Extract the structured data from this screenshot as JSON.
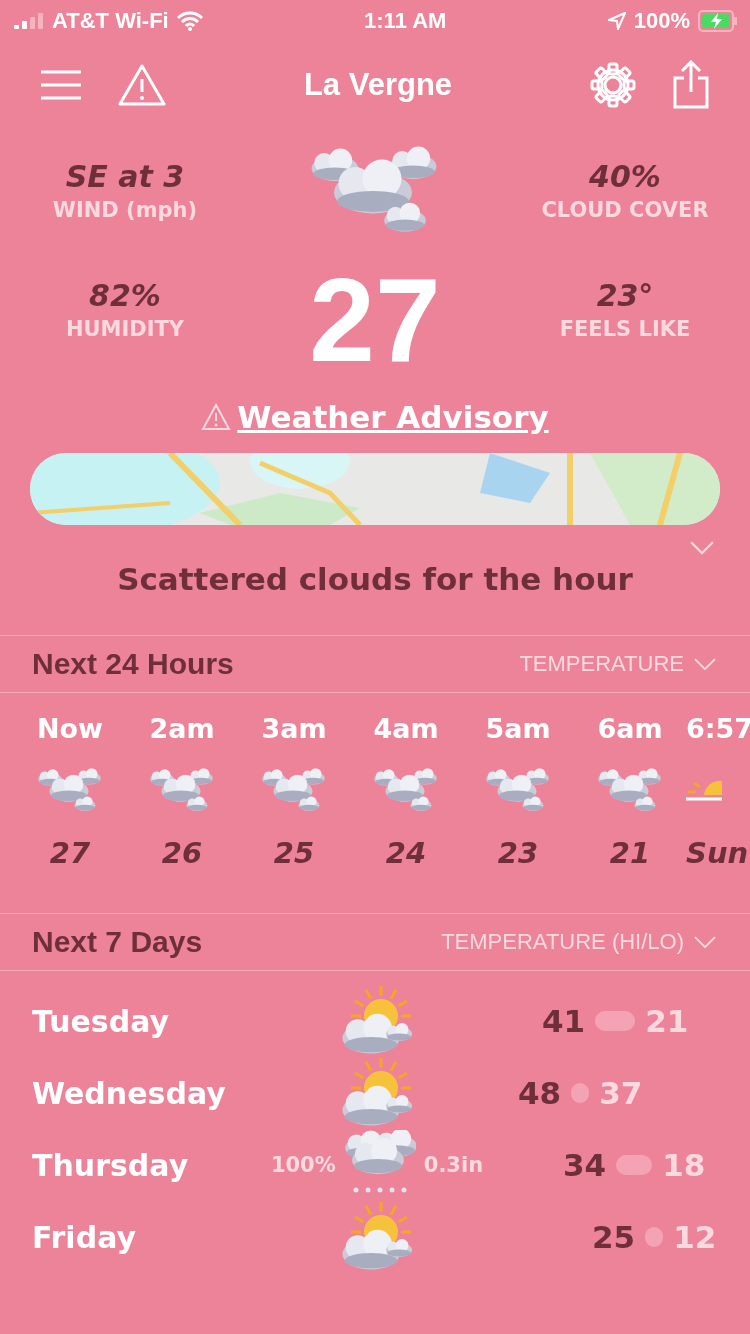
{
  "status_bar": {
    "carrier": "AT&T Wi-Fi",
    "time": "1:11 AM",
    "battery": "100%"
  },
  "header": {
    "title": "La Vergne"
  },
  "current": {
    "wind": {
      "value": "SE at 3",
      "label": "WIND (mph)"
    },
    "cloud_cover": {
      "value": "40%",
      "label": "CLOUD COVER"
    },
    "humidity": {
      "value": "82%",
      "label": "HUMIDITY"
    },
    "feels_like": {
      "value": "23°",
      "label": "FEELS LIKE"
    },
    "temperature": "27",
    "advisory": "Weather Advisory"
  },
  "summary": "Scattered clouds for the hour",
  "hourly": {
    "title": "Next 24 Hours",
    "selector": "TEMPERATURE",
    "items": [
      {
        "time": "Now",
        "kind": "cloudy",
        "value": "27"
      },
      {
        "time": "2am",
        "kind": "cloudy",
        "value": "26"
      },
      {
        "time": "3am",
        "kind": "cloudy",
        "value": "25"
      },
      {
        "time": "4am",
        "kind": "cloudy",
        "value": "24"
      },
      {
        "time": "5am",
        "kind": "cloudy",
        "value": "23"
      },
      {
        "time": "6am",
        "kind": "cloudy",
        "value": "21"
      },
      {
        "time": "6:57",
        "kind": "sunrise",
        "value": "Sun"
      }
    ]
  },
  "daily": {
    "title": "Next 7 Days",
    "selector": "TEMPERATURE (HI/LO)",
    "days": [
      {
        "day": "Tuesday",
        "kind": "partly",
        "hi": "41",
        "lo": "21"
      },
      {
        "day": "Wednesday",
        "kind": "partly",
        "hi": "48",
        "lo": "37"
      },
      {
        "day": "Thursday",
        "kind": "snow",
        "chance": "100%",
        "amount": "0.3in",
        "hi": "34",
        "lo": "18"
      },
      {
        "day": "Friday",
        "kind": "partly",
        "hi": "25",
        "lo": "12"
      }
    ]
  }
}
